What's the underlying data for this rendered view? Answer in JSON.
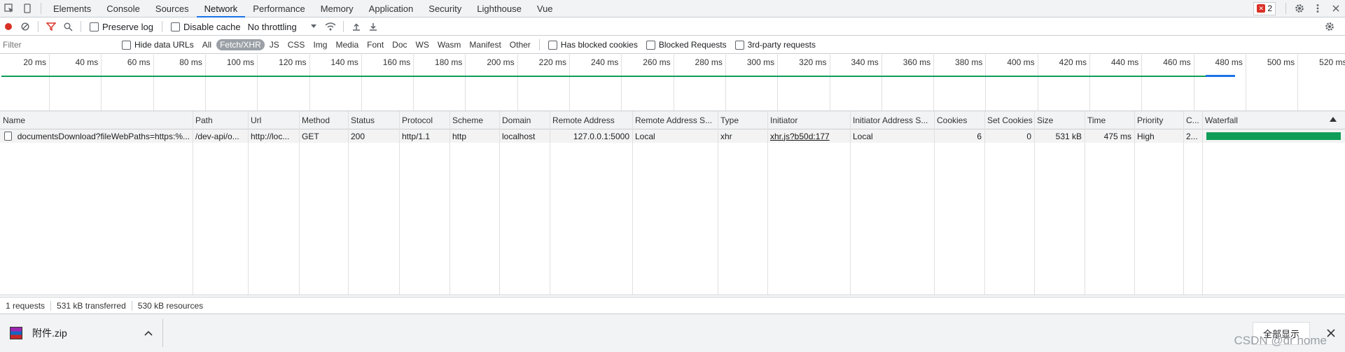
{
  "tabbar": {
    "tabs": [
      "Elements",
      "Console",
      "Sources",
      "Network",
      "Performance",
      "Memory",
      "Application",
      "Security",
      "Lighthouse",
      "Vue"
    ],
    "active": "Network",
    "error_count": "2"
  },
  "toolbar": {
    "preserve_log": "Preserve log",
    "disable_cache": "Disable cache",
    "throttling": "No throttling"
  },
  "filter": {
    "placeholder": "Filter",
    "hide_data_urls": "Hide data URLs",
    "types": [
      "All",
      "Fetch/XHR",
      "JS",
      "CSS",
      "Img",
      "Media",
      "Font",
      "Doc",
      "WS",
      "Wasm",
      "Manifest",
      "Other"
    ],
    "active_type": "Fetch/XHR",
    "has_blocked_cookies": "Has blocked cookies",
    "blocked_requests": "Blocked Requests",
    "third_party": "3rd-party requests"
  },
  "overview": {
    "ticks": [
      "20 ms",
      "40 ms",
      "60 ms",
      "80 ms",
      "100 ms",
      "120 ms",
      "140 ms",
      "160 ms",
      "180 ms",
      "200 ms",
      "220 ms",
      "240 ms",
      "260 ms",
      "280 ms",
      "300 ms",
      "320 ms",
      "340 ms",
      "360 ms",
      "380 ms",
      "400 ms",
      "420 ms",
      "440 ms",
      "460 ms",
      "480 ms",
      "500 ms",
      "520 ms"
    ]
  },
  "table": {
    "headers": [
      "Name",
      "Path",
      "Url",
      "Method",
      "Status",
      "Protocol",
      "Scheme",
      "Domain",
      "Remote Address",
      "Remote Address S...",
      "Type",
      "Initiator",
      "Initiator Address S...",
      "Cookies",
      "Set Cookies",
      "Size",
      "Time",
      "Priority",
      "C...",
      "Waterfall"
    ],
    "rows": [
      [
        "documentsDownload?fileWebPaths=https:%...",
        "/dev-api/o...",
        "http://loc...",
        "GET",
        "200",
        "http/1.1",
        "http",
        "localhost",
        "127.0.0.1:5000",
        "Local",
        "xhr",
        "xhr.js?b50d:177",
        "Local",
        "6",
        "0",
        "531 kB",
        "475 ms",
        "High",
        "2...",
        ""
      ]
    ]
  },
  "status": {
    "requests": "1 requests",
    "transferred": "531 kB transferred",
    "resources": "530 kB resources"
  },
  "downloads": {
    "file": "附件.zip",
    "show_all": "全部显示"
  },
  "watermark": "CSDN @dr home",
  "colors": {
    "accent": "#1a73e8",
    "waterfall": "#0f9d58",
    "error": "#d93025"
  }
}
